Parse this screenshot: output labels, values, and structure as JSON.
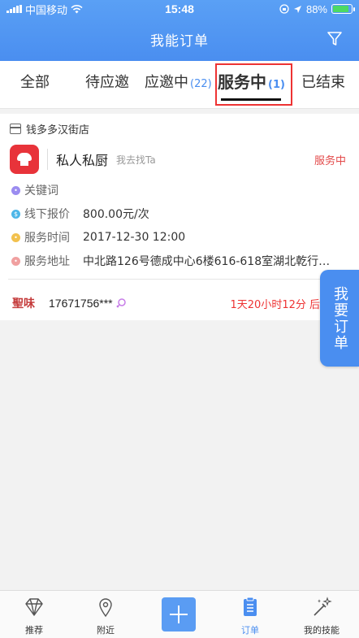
{
  "status_bar": {
    "carrier": "中国移动",
    "time": "15:48",
    "battery": "88%"
  },
  "header": {
    "title": "我能订单"
  },
  "tabs": [
    {
      "label": "全部",
      "count": ""
    },
    {
      "label": "待应邀",
      "count": ""
    },
    {
      "label": "应邀中",
      "count": "(22)"
    },
    {
      "label": "服务中",
      "count": "(1)"
    },
    {
      "label": "已结束",
      "count": ""
    }
  ],
  "order": {
    "shop_name": "钱多多汉街店",
    "service_name": "私人私厨",
    "find_link": "我去找Ta",
    "status": "服务中",
    "fields": [
      {
        "label": "关键词",
        "value": "",
        "color": "#9b8cf0"
      },
      {
        "label": "线下报价",
        "value": "800.00元/次",
        "color": "#4db6e8"
      },
      {
        "label": "服务时间",
        "value": "2017-12-30 12:00",
        "color": "#f2c14e"
      },
      {
        "label": "服务地址",
        "value": "中北路126号德成中心6楼616-618室湖北乾行…",
        "color": "#f0a0a0"
      }
    ],
    "user_avatar_text": "聖味",
    "phone": "17671756***",
    "time_left": "1天20小时12分 后进行"
  },
  "float_button": {
    "label": "我要订单"
  },
  "bottom_tabs": [
    {
      "label": "推荐",
      "icon": "diamond-icon"
    },
    {
      "label": "附近",
      "icon": "location-pin-icon"
    },
    {
      "label": "",
      "icon": "plus-icon"
    },
    {
      "label": "订单",
      "icon": "clipboard-icon"
    },
    {
      "label": "我的技能",
      "icon": "magic-wand-icon"
    }
  ],
  "colors": {
    "primary": "#4a8ef0",
    "status_red": "#e34a4a",
    "highlight_box": "#ee3333"
  }
}
